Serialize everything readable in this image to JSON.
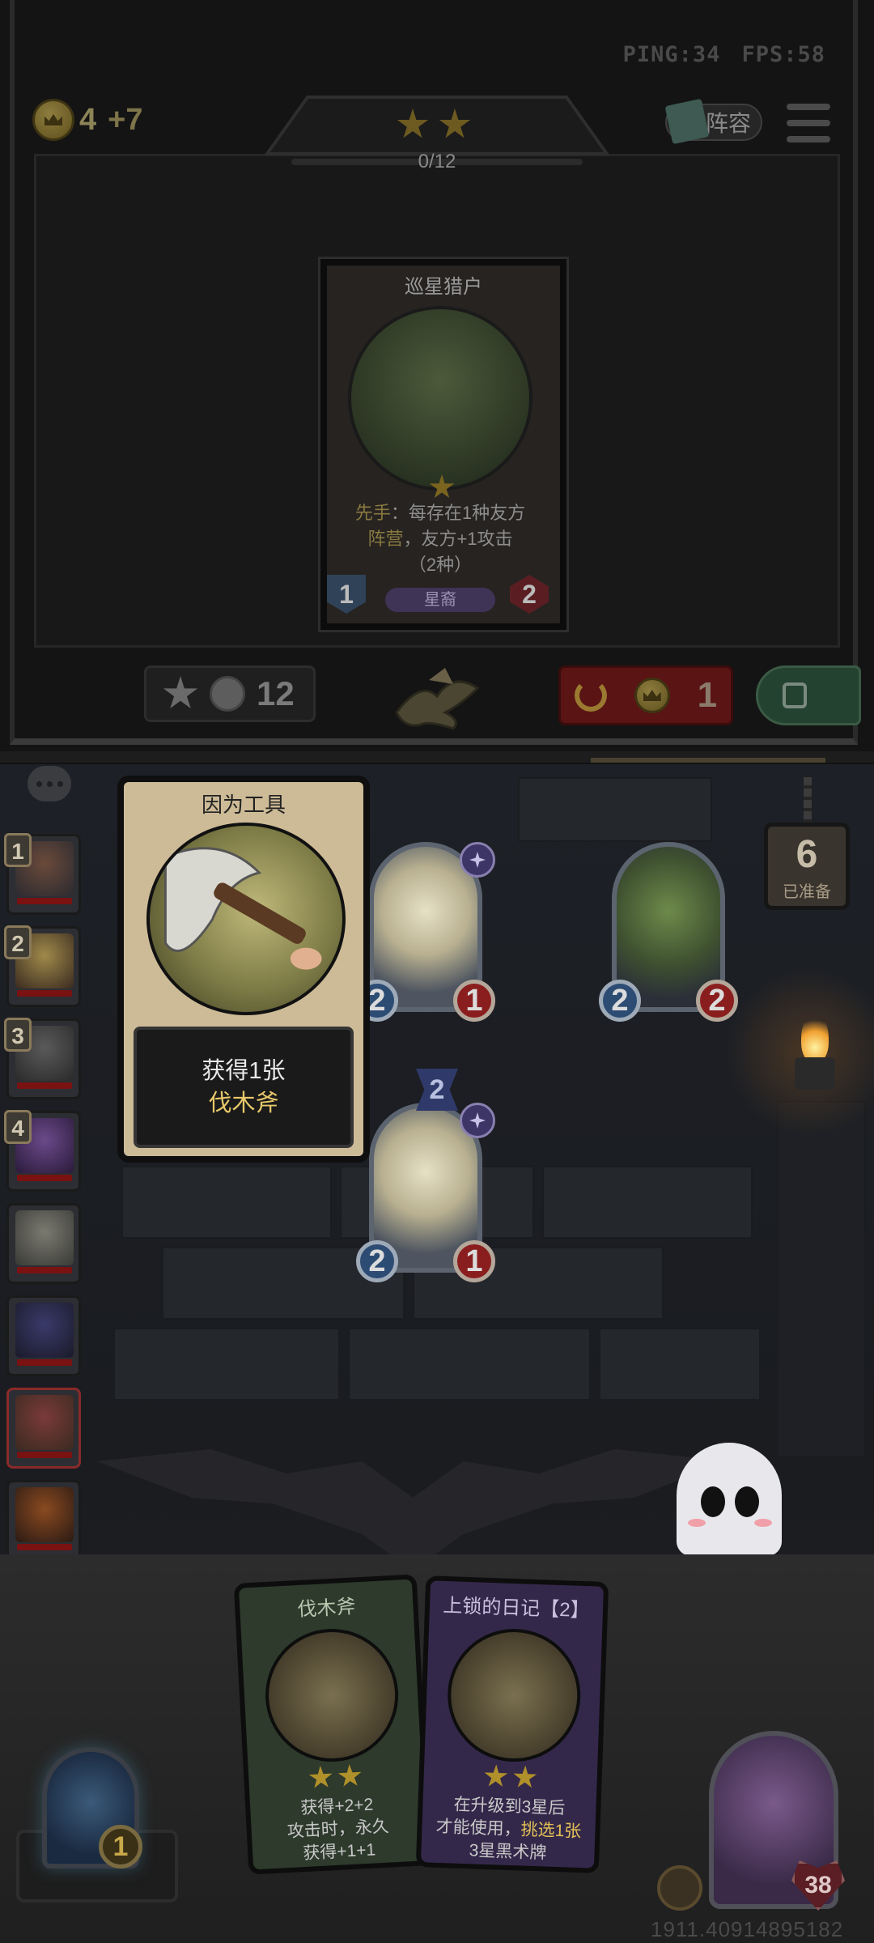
{
  "hud": {
    "ping": "PING:34",
    "fps": "FPS:58",
    "gold": "4",
    "gold_plus": "+7",
    "tavern_stars": 2,
    "xp_text": "0/12",
    "lineup_label": "阵容"
  },
  "shop_card": {
    "title": "巡星猎户",
    "stars": 1,
    "text_keyword": "先手",
    "text_pre": "：每存在1种友方",
    "text_keyword2": "阵营",
    "text_post": "，友方+1攻击",
    "text_count": "（2种）",
    "tribe": "星裔",
    "attack": "1",
    "health": "2"
  },
  "shop_buttons": {
    "upgrade_cost": "12",
    "refresh_cost": "1"
  },
  "popup_card": {
    "title": "因为工具",
    "line1": "获得1张",
    "line2": "伐木斧"
  },
  "opponents": [
    {
      "rank": "1",
      "colors": [
        "#6a4a3a",
        "#2b2a30"
      ]
    },
    {
      "rank": "2",
      "colors": [
        "#a08a4a",
        "#3a2a20"
      ]
    },
    {
      "rank": "3",
      "colors": [
        "#5a5a5a",
        "#2a2a2a"
      ]
    },
    {
      "rank": "4",
      "colors": [
        "#6a4a8a",
        "#2a1a3a"
      ]
    },
    {
      "rank": "",
      "colors": [
        "#7a7a70",
        "#3a3a36"
      ]
    },
    {
      "rank": "",
      "colors": [
        "#3a3a6a",
        "#1a1a2a"
      ]
    },
    {
      "rank": "",
      "colors": [
        "#7a3a3a",
        "#3a2a20"
      ]
    },
    {
      "rank": "",
      "colors": [
        "#8a4a20",
        "#2a1a14"
      ]
    }
  ],
  "minions": [
    {
      "name": "priest-minion-1",
      "attack": "2",
      "health": "1",
      "has_gem": true
    },
    {
      "name": "goblin-minion",
      "attack": "2",
      "health": "2",
      "has_gem": false
    },
    {
      "name": "priest-minion-2",
      "attack": "2",
      "health": "1",
      "has_gem": true,
      "tier": "2"
    }
  ],
  "ready": {
    "count": "6",
    "label": "已准备"
  },
  "hand": [
    {
      "title": "伐木斧",
      "stars": 2,
      "text": "获得+2+2\n攻击时，永久\n获得+1+1",
      "color": "#2d3a2c"
    },
    {
      "title": "上锁的日记【2】",
      "stars": 2,
      "text_pre": "在升级到3星后\n才能使用，",
      "text_kw": "挑选1张",
      "text_post": "\n3星黑术牌",
      "color": "#34284a"
    }
  ],
  "hero": {
    "health": "38"
  },
  "portal": {
    "coin": "1"
  },
  "footer_id": "1911.40914895182",
  "colors": {
    "refresh_button": "#5a1414",
    "lock_button": "#23422f",
    "popup_card_bg": "#cdbb97",
    "highlight_text": "#e8c96a"
  }
}
